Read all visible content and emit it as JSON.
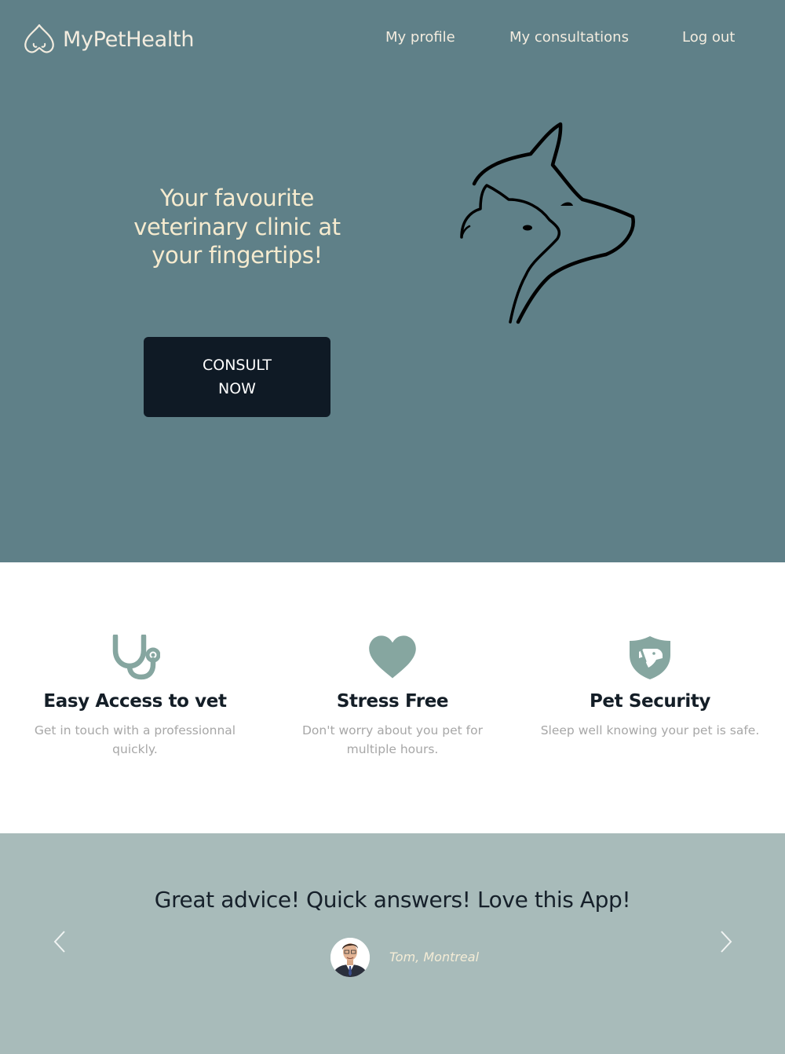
{
  "header": {
    "brand": "MyPetHealth",
    "logo_icon": "paw-heart-icon",
    "nav": [
      {
        "label": "My profile"
      },
      {
        "label": "My consultations"
      },
      {
        "label": "Log out"
      }
    ]
  },
  "hero": {
    "title": "Your favourite veterinary clinic at your fingertips!",
    "cta_line1": "CONSULT",
    "cta_line2": "NOW",
    "illustration": "dog-cat-silhouette-icon"
  },
  "features": [
    {
      "icon": "stethoscope-icon",
      "title": "Easy Access to vet",
      "text": "Get in touch with a professionnal quickly."
    },
    {
      "icon": "heart-icon",
      "title": "Stress Free",
      "text": "Don't worry about you pet for multiple hours."
    },
    {
      "icon": "dog-shield-icon",
      "title": "Pet Security",
      "text": "Sleep well knowing your pet is safe."
    }
  ],
  "testimonial": {
    "quote": "Great advice! Quick answers! Love this App!",
    "author": "Tom, Montreal",
    "prev_icon": "chevron-left-icon",
    "next_icon": "chevron-right-icon"
  },
  "colors": {
    "hero_bg": "#5f8088",
    "cta_bg": "#0f1a25",
    "accent": "#86a6a0",
    "testimonial_bg": "#a8bbba"
  }
}
